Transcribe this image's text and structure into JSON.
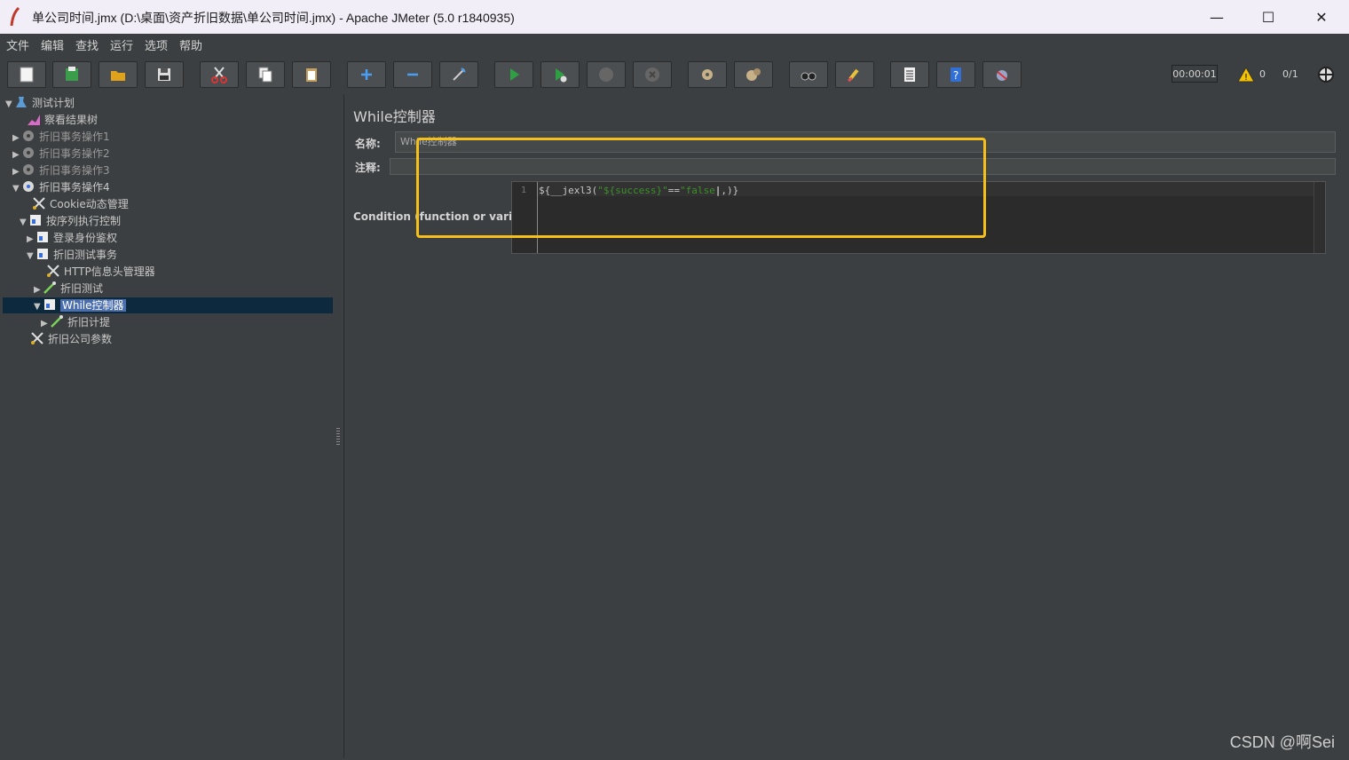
{
  "window": {
    "title": "单公司时间.jmx (D:\\桌面\\资产折旧数据\\单公司时间.jmx) - Apache JMeter (5.0 r1840935)",
    "minimize": "—",
    "maximize": "☐",
    "close": "✕"
  },
  "menu": [
    "文件",
    "编辑",
    "查找",
    "运行",
    "选项",
    "帮助"
  ],
  "toolbar": {
    "buttons": [
      "new-icon",
      "templates-icon",
      "open-icon",
      "save-icon",
      "cut-icon",
      "copy-icon",
      "paste-icon",
      "expand-icon",
      "collapse-icon",
      "toggle-icon",
      "start-icon",
      "start-no-pause-icon",
      "stop-icon",
      "shutdown-icon",
      "clear-icon",
      "clear-all-icon",
      "search-icon",
      "reset-search-icon",
      "function-helper-icon",
      "help-icon",
      "remote-icon"
    ],
    "timer": "00:00:01",
    "warnings": "0",
    "threads": "0/1"
  },
  "tree": {
    "items": [
      {
        "label": "测试计划",
        "icon": "test-plan-icon"
      },
      {
        "label": "察看结果树",
        "icon": "listener-icon"
      },
      {
        "label": "折旧事务操作1",
        "icon": "thread-group-icon"
      },
      {
        "label": "折旧事务操作2",
        "icon": "thread-group-icon"
      },
      {
        "label": "折旧事务操作3",
        "icon": "thread-group-icon"
      },
      {
        "label": "折旧事务操作4",
        "icon": "thread-group-icon"
      },
      {
        "label": "Cookie动态管理",
        "icon": "config-icon"
      },
      {
        "label": "按序列执行控制",
        "icon": "controller-icon"
      },
      {
        "label": "登录身份鉴权",
        "icon": "controller-icon"
      },
      {
        "label": "折旧测试事务",
        "icon": "controller-icon"
      },
      {
        "label": "HTTP信息头管理器",
        "icon": "config-icon"
      },
      {
        "label": "折旧测试",
        "icon": "sampler-icon"
      },
      {
        "label": "While控制器",
        "icon": "controller-icon"
      },
      {
        "label": "折旧计提",
        "icon": "sampler-icon"
      },
      {
        "label": "折旧公司参数",
        "icon": "config-icon"
      }
    ],
    "selected": "While控制器"
  },
  "panel": {
    "title": "While控制器",
    "name_label": "名称:",
    "name_value": "While控制器",
    "comment_label": "注释:",
    "comment_value": "",
    "condition_label": "Condition (function or variable)",
    "editor": {
      "line_number": "1",
      "code_prefix": "${__jexl3(",
      "code_string1": "\"${success}\"",
      "code_operator": "==",
      "code_string2": "\"false",
      "code_suffix": ",)}"
    }
  },
  "annotation_color": "#f5c01a",
  "watermark": "CSDN @啊Sei"
}
